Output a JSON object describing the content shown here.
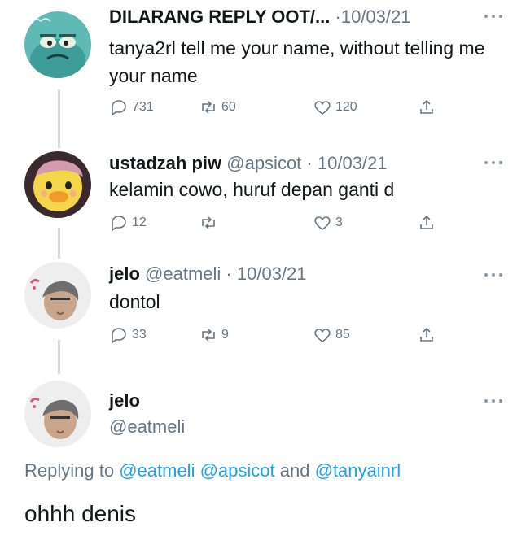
{
  "tweets": [
    {
      "name": "DILARANG REPLY OOT/...",
      "handle": "",
      "sep": "·",
      "date": "10/03/21",
      "text": "tanya2rl tell me your name, without telling me your name",
      "replies": "731",
      "retweets": "60",
      "likes": "120",
      "avatar_icon": "fish-cartoon-avatar"
    },
    {
      "name": "ustadzah piw",
      "handle": "@apsicot",
      "sep": "·",
      "date": "10/03/21",
      "text": "kelamin cowo, huruf depan ganti d",
      "replies": "12",
      "retweets": "",
      "likes": "3",
      "avatar_icon": "duck-avatar"
    },
    {
      "name": "jelo",
      "handle": "@eatmeli",
      "sep": "·",
      "date": "10/03/21",
      "text": "dontol",
      "replies": "33",
      "retweets": "9",
      "likes": "85",
      "avatar_icon": "girl-selfie-avatar"
    }
  ],
  "main_tweet": {
    "name": "jelo",
    "handle": "@eatmeli",
    "replying_prefix": "Replying to",
    "replying_1": "@eatmeli",
    "replying_2": "@apsicot",
    "replying_and": "and",
    "replying_3": "@tanyainrl",
    "text": "ohhh denis"
  },
  "colors": {
    "link": "#1da1f2",
    "secondary": "#657786",
    "thread_line": "#cfd9de"
  }
}
